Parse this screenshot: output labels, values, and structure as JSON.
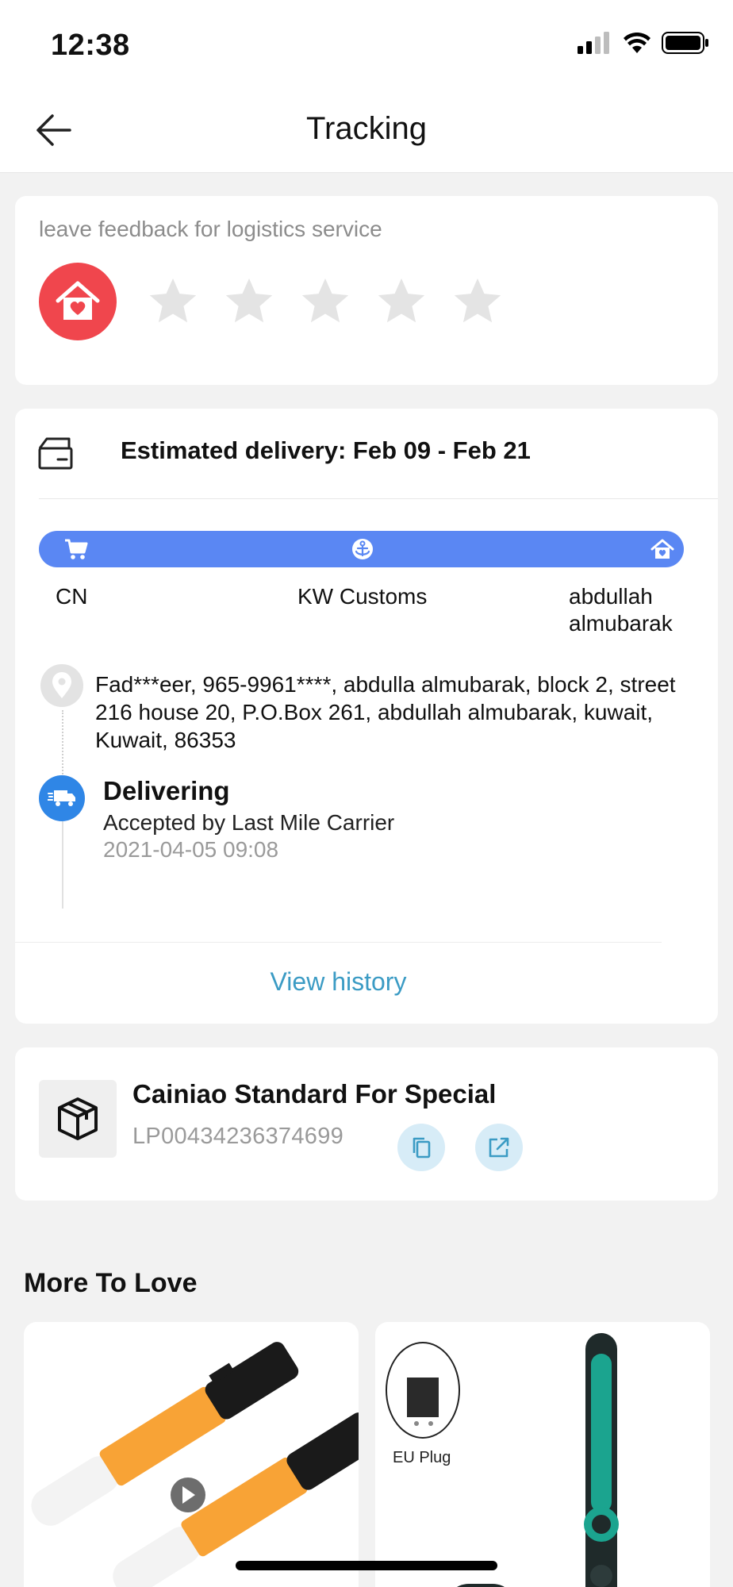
{
  "status_bar": {
    "time": "12:38"
  },
  "nav": {
    "title": "Tracking",
    "back_icon": "arrow-left-icon"
  },
  "feedback": {
    "label": "leave feedback for logistics service",
    "avatar_icon": "house-heart-icon",
    "rating": 0,
    "max_rating": 5
  },
  "tracking": {
    "estimated_delivery": "Estimated delivery: Feb 09 - Feb 21",
    "progress_color": "#5a87f3",
    "stages": [
      {
        "label": "CN",
        "icon": "cart-icon"
      },
      {
        "label": "KW Customs",
        "icon": "anchor-icon"
      },
      {
        "label": "abdullah almubarak",
        "icon": "house-icon"
      }
    ],
    "address": "Fad***eer,  965-9961****,  abdulla almubarak, block 2, street 216 house 20, P.O.Box 261,  abdullah almubarak,  kuwait,  Kuwait,  86353",
    "latest_event": {
      "status": "Delivering",
      "description": "Accepted by Last Mile Carrier",
      "timestamp": "2021-04-05 09:08"
    },
    "view_history": "View history"
  },
  "carrier": {
    "name": "Cainiao Standard For Special",
    "tracking_number": "LP00434236374699",
    "copy_icon": "copy-icon",
    "open_icon": "external-link-icon"
  },
  "more_to_love": {
    "title": "More To Love",
    "products": [
      {
        "image": "voltage-tester-pens-image"
      },
      {
        "image": "electric-tester-eu-plug-image",
        "badge": "EU Plug"
      }
    ]
  }
}
